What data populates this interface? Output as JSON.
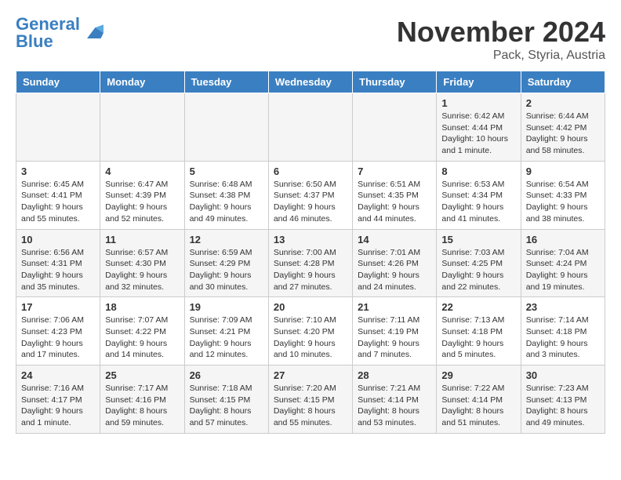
{
  "header": {
    "logo_general": "General",
    "logo_blue": "Blue",
    "month_title": "November 2024",
    "location": "Pack, Styria, Austria"
  },
  "weekdays": [
    "Sunday",
    "Monday",
    "Tuesday",
    "Wednesday",
    "Thursday",
    "Friday",
    "Saturday"
  ],
  "weeks": [
    [
      {
        "day": "",
        "info": ""
      },
      {
        "day": "",
        "info": ""
      },
      {
        "day": "",
        "info": ""
      },
      {
        "day": "",
        "info": ""
      },
      {
        "day": "",
        "info": ""
      },
      {
        "day": "1",
        "info": "Sunrise: 6:42 AM\nSunset: 4:44 PM\nDaylight: 10 hours and 1 minute."
      },
      {
        "day": "2",
        "info": "Sunrise: 6:44 AM\nSunset: 4:42 PM\nDaylight: 9 hours and 58 minutes."
      }
    ],
    [
      {
        "day": "3",
        "info": "Sunrise: 6:45 AM\nSunset: 4:41 PM\nDaylight: 9 hours and 55 minutes."
      },
      {
        "day": "4",
        "info": "Sunrise: 6:47 AM\nSunset: 4:39 PM\nDaylight: 9 hours and 52 minutes."
      },
      {
        "day": "5",
        "info": "Sunrise: 6:48 AM\nSunset: 4:38 PM\nDaylight: 9 hours and 49 minutes."
      },
      {
        "day": "6",
        "info": "Sunrise: 6:50 AM\nSunset: 4:37 PM\nDaylight: 9 hours and 46 minutes."
      },
      {
        "day": "7",
        "info": "Sunrise: 6:51 AM\nSunset: 4:35 PM\nDaylight: 9 hours and 44 minutes."
      },
      {
        "day": "8",
        "info": "Sunrise: 6:53 AM\nSunset: 4:34 PM\nDaylight: 9 hours and 41 minutes."
      },
      {
        "day": "9",
        "info": "Sunrise: 6:54 AM\nSunset: 4:33 PM\nDaylight: 9 hours and 38 minutes."
      }
    ],
    [
      {
        "day": "10",
        "info": "Sunrise: 6:56 AM\nSunset: 4:31 PM\nDaylight: 9 hours and 35 minutes."
      },
      {
        "day": "11",
        "info": "Sunrise: 6:57 AM\nSunset: 4:30 PM\nDaylight: 9 hours and 32 minutes."
      },
      {
        "day": "12",
        "info": "Sunrise: 6:59 AM\nSunset: 4:29 PM\nDaylight: 9 hours and 30 minutes."
      },
      {
        "day": "13",
        "info": "Sunrise: 7:00 AM\nSunset: 4:28 PM\nDaylight: 9 hours and 27 minutes."
      },
      {
        "day": "14",
        "info": "Sunrise: 7:01 AM\nSunset: 4:26 PM\nDaylight: 9 hours and 24 minutes."
      },
      {
        "day": "15",
        "info": "Sunrise: 7:03 AM\nSunset: 4:25 PM\nDaylight: 9 hours and 22 minutes."
      },
      {
        "day": "16",
        "info": "Sunrise: 7:04 AM\nSunset: 4:24 PM\nDaylight: 9 hours and 19 minutes."
      }
    ],
    [
      {
        "day": "17",
        "info": "Sunrise: 7:06 AM\nSunset: 4:23 PM\nDaylight: 9 hours and 17 minutes."
      },
      {
        "day": "18",
        "info": "Sunrise: 7:07 AM\nSunset: 4:22 PM\nDaylight: 9 hours and 14 minutes."
      },
      {
        "day": "19",
        "info": "Sunrise: 7:09 AM\nSunset: 4:21 PM\nDaylight: 9 hours and 12 minutes."
      },
      {
        "day": "20",
        "info": "Sunrise: 7:10 AM\nSunset: 4:20 PM\nDaylight: 9 hours and 10 minutes."
      },
      {
        "day": "21",
        "info": "Sunrise: 7:11 AM\nSunset: 4:19 PM\nDaylight: 9 hours and 7 minutes."
      },
      {
        "day": "22",
        "info": "Sunrise: 7:13 AM\nSunset: 4:18 PM\nDaylight: 9 hours and 5 minutes."
      },
      {
        "day": "23",
        "info": "Sunrise: 7:14 AM\nSunset: 4:18 PM\nDaylight: 9 hours and 3 minutes."
      }
    ],
    [
      {
        "day": "24",
        "info": "Sunrise: 7:16 AM\nSunset: 4:17 PM\nDaylight: 9 hours and 1 minute."
      },
      {
        "day": "25",
        "info": "Sunrise: 7:17 AM\nSunset: 4:16 PM\nDaylight: 8 hours and 59 minutes."
      },
      {
        "day": "26",
        "info": "Sunrise: 7:18 AM\nSunset: 4:15 PM\nDaylight: 8 hours and 57 minutes."
      },
      {
        "day": "27",
        "info": "Sunrise: 7:20 AM\nSunset: 4:15 PM\nDaylight: 8 hours and 55 minutes."
      },
      {
        "day": "28",
        "info": "Sunrise: 7:21 AM\nSunset: 4:14 PM\nDaylight: 8 hours and 53 minutes."
      },
      {
        "day": "29",
        "info": "Sunrise: 7:22 AM\nSunset: 4:14 PM\nDaylight: 8 hours and 51 minutes."
      },
      {
        "day": "30",
        "info": "Sunrise: 7:23 AM\nSunset: 4:13 PM\nDaylight: 8 hours and 49 minutes."
      }
    ]
  ]
}
